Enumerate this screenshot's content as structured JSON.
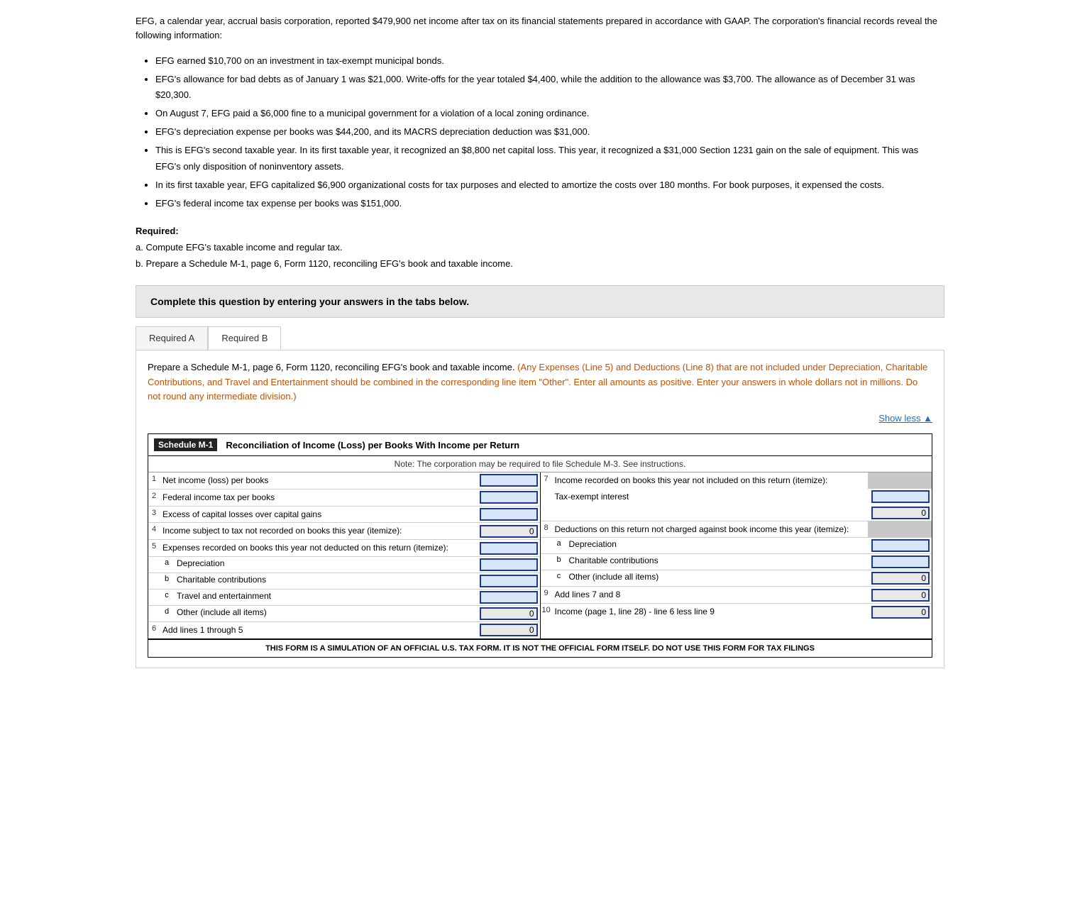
{
  "intro": {
    "paragraph": "EFG, a calendar year, accrual basis corporation, reported $479,900 net income after tax on its financial statements prepared in accordance with GAAP. The corporation's financial records reveal the following information:"
  },
  "bullets": [
    "EFG earned $10,700 on an investment in tax-exempt municipal bonds.",
    "EFG's allowance for bad debts as of January 1 was $21,000. Write-offs for the year totaled $4,400, while the addition to the allowance was $3,700. The allowance as of December 31 was $20,300.",
    "On August 7, EFG paid a $6,000 fine to a municipal government for a violation of a local zoning ordinance.",
    "EFG's depreciation expense per books was $44,200, and its MACRS depreciation deduction was $31,000.",
    "This is EFG's second taxable year. In its first taxable year, it recognized an $8,800 net capital loss. This year, it recognized a $31,000 Section 1231 gain on the sale of equipment. This was EFG's only disposition of noninventory assets.",
    "In its first taxable year, EFG capitalized $6,900 organizational costs for tax purposes and elected to amortize the costs over 180 months. For book purposes, it expensed the costs.",
    "EFG's federal income tax expense per books was $151,000."
  ],
  "required": {
    "label": "Required:",
    "a": "a. Compute EFG's taxable income and regular tax.",
    "b": "b. Prepare a Schedule M-1, page 6, Form 1120, reconciling EFG's book and taxable income."
  },
  "question_box": {
    "title": "Complete this question by entering your answers in the tabs below."
  },
  "tabs": [
    {
      "label": "Required A",
      "active": false
    },
    {
      "label": "Required B",
      "active": true
    }
  ],
  "tab_content": {
    "instruction_normal": "Prepare a Schedule M-1, page 6, Form 1120, reconciling EFG's book and taxable income.",
    "instruction_orange": "(Any Expenses (Line 5) and Deductions (Line 8) that are not included under Depreciation, Charitable Contributions, and Travel and Entertainment should be combined in the corresponding line item \"Other\". Enter all amounts as positive. Enter your answers in whole dollars not in millions. Do not round any intermediate division.)",
    "show_less": "Show less ▲"
  },
  "schedule": {
    "badge": "Schedule M-1",
    "title": "Reconciliation of Income (Loss) per Books With Income per Return",
    "note": "Note: The corporation may be required to file Schedule M-3. See instructions.",
    "left_rows": [
      {
        "num": "1",
        "label": "Net income (loss) per books",
        "input_type": "blue_empty"
      },
      {
        "num": "2",
        "label": "Federal income tax per books",
        "input_type": "blue_empty"
      },
      {
        "num": "3",
        "label": "Excess of capital losses over capital gains",
        "input_type": "blue_empty"
      },
      {
        "num": "4",
        "label": "Income subject to tax not recorded on books this year (itemize):",
        "value": "0",
        "input_type": "value_zero"
      }
    ],
    "left_sub5": {
      "num": "5",
      "label": "Expenses recorded on books this year not deducted on this return (itemize):",
      "subs": [
        {
          "letter": "a",
          "label": "Depreciation",
          "input_type": "blue_empty"
        },
        {
          "letter": "b",
          "label": "Charitable contributions",
          "input_type": "blue_empty"
        },
        {
          "letter": "c",
          "label": "Travel and entertainment",
          "input_type": "blue_empty"
        },
        {
          "letter": "d",
          "label": "Other (include all items)",
          "value": "0",
          "input_type": "value_zero"
        }
      ]
    },
    "left_row6": {
      "num": "6",
      "label": "Add lines 1 through 5",
      "value": "0"
    },
    "right_rows": [
      {
        "num": "7",
        "label": "Income recorded on books this year not included on this return (itemize):",
        "sub_label": "Tax-exempt interest",
        "input_type": "blue_empty",
        "value_right": "0"
      }
    ],
    "right_sub8": {
      "num": "8",
      "label": "Deductions on this return not charged against book income this year (itemize):",
      "subs": [
        {
          "letter": "a",
          "label": "Depreciation",
          "input_type": "blue_empty"
        },
        {
          "letter": "b",
          "label": "Charitable contributions",
          "input_type": "blue_empty"
        },
        {
          "letter": "c",
          "label": "Other (include all items)",
          "value": "0",
          "input_type": "value_zero"
        }
      ]
    },
    "right_row9": {
      "num": "9",
      "label": "Add lines 7 and 8",
      "value": "0"
    },
    "right_row10": {
      "num": "10",
      "label": "Income (page 1, line 28) - line 6 less line 9",
      "value": "0"
    },
    "footer": "THIS FORM IS A SIMULATION OF AN OFFICIAL U.S. TAX FORM. IT IS NOT THE OFFICIAL FORM ITSELF. DO NOT USE THIS FORM FOR TAX FILINGS"
  }
}
